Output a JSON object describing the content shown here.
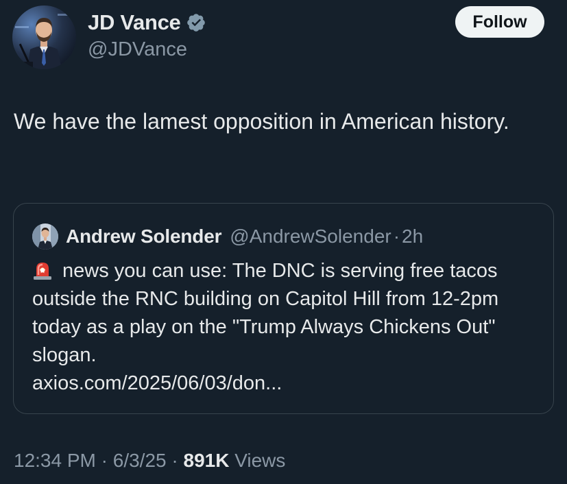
{
  "author": {
    "display_name": "JD Vance",
    "handle": "@JDVance",
    "verified_icon": "verified-badge-icon"
  },
  "follow_label": "Follow",
  "tweet": {
    "text": "We have the lamest opposition in American history."
  },
  "quote": {
    "author_name": "Andrew Solender",
    "author_handle": "@AndrewSolender",
    "separator": "·",
    "time": "2h",
    "siren_icon": "rotating-light-icon",
    "body": "news you can use: The DNC is serving free tacos outside the RNC building on Capitol Hill from 12-2pm today as a play on the \"Trump Always Chickens Out\" slogan.",
    "link": "axios.com/2025/06/03/don..."
  },
  "meta": {
    "time": "12:34 PM",
    "sep1": "·",
    "date": "6/3/25",
    "sep2": "·",
    "views_count": "891K",
    "views_label": "Views"
  },
  "colors": {
    "background": "#15202b",
    "primary_text": "#e7e9ea",
    "secondary_text": "#8b98a5",
    "border": "#38444d",
    "verified": "#829aab",
    "follow_bg": "#eff3f4"
  }
}
